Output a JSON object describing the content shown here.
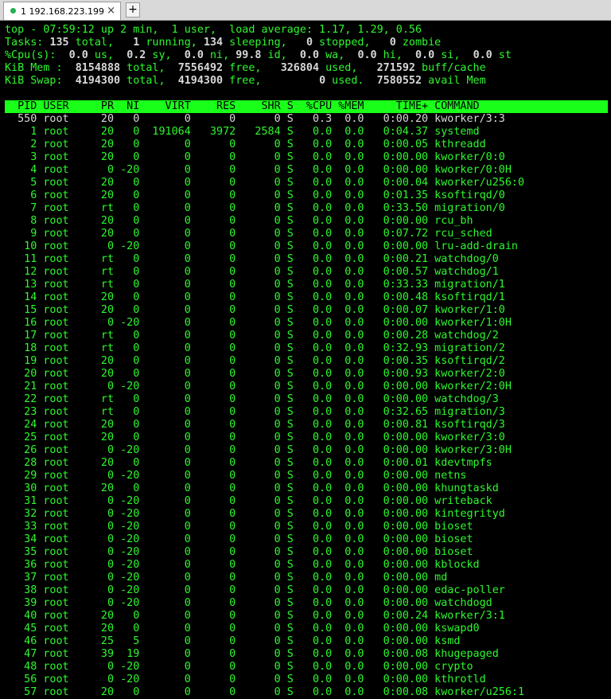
{
  "tab": {
    "title": "1 192.168.223.199",
    "close": "×",
    "new": "+"
  },
  "summary": {
    "l1": "top - 07:59:12 up 2 min,  1 user,  load average: 1.17, 1.29, 0.56",
    "tasks": [
      "135",
      "1",
      "134",
      "0",
      "0"
    ],
    "cpu": [
      "0.0",
      "0.2",
      "0.0",
      "99.8",
      "0.0",
      "0.0",
      "0.0",
      "0.0"
    ],
    "mem": [
      "8154888",
      "7556492",
      "326804",
      "271592"
    ],
    "swap": [
      "4194300",
      "4194300",
      "0",
      "7580552"
    ]
  },
  "columns": [
    "PID",
    "USER",
    "PR",
    "NI",
    "VIRT",
    "RES",
    "SHR",
    "S",
    "%CPU",
    "%MEM",
    "TIME+",
    "COMMAND"
  ],
  "processes": [
    [
      "550",
      "root",
      "20",
      "0",
      "0",
      "0",
      "0",
      "S",
      "0.3",
      "0.0",
      "0:00.20",
      "kworker/3:3"
    ],
    [
      "1",
      "root",
      "20",
      "0",
      "191064",
      "3972",
      "2584",
      "S",
      "0.0",
      "0.0",
      "0:04.37",
      "systemd"
    ],
    [
      "2",
      "root",
      "20",
      "0",
      "0",
      "0",
      "0",
      "S",
      "0.0",
      "0.0",
      "0:00.05",
      "kthreadd"
    ],
    [
      "3",
      "root",
      "20",
      "0",
      "0",
      "0",
      "0",
      "S",
      "0.0",
      "0.0",
      "0:00.00",
      "kworker/0:0"
    ],
    [
      "4",
      "root",
      "0",
      "-20",
      "0",
      "0",
      "0",
      "S",
      "0.0",
      "0.0",
      "0:00.00",
      "kworker/0:0H"
    ],
    [
      "5",
      "root",
      "20",
      "0",
      "0",
      "0",
      "0",
      "S",
      "0.0",
      "0.0",
      "0:00.04",
      "kworker/u256:0"
    ],
    [
      "6",
      "root",
      "20",
      "0",
      "0",
      "0",
      "0",
      "S",
      "0.0",
      "0.0",
      "0:01.35",
      "ksoftirqd/0"
    ],
    [
      "7",
      "root",
      "rt",
      "0",
      "0",
      "0",
      "0",
      "S",
      "0.0",
      "0.0",
      "0:33.50",
      "migration/0"
    ],
    [
      "8",
      "root",
      "20",
      "0",
      "0",
      "0",
      "0",
      "S",
      "0.0",
      "0.0",
      "0:00.00",
      "rcu_bh"
    ],
    [
      "9",
      "root",
      "20",
      "0",
      "0",
      "0",
      "0",
      "S",
      "0.0",
      "0.0",
      "0:07.72",
      "rcu_sched"
    ],
    [
      "10",
      "root",
      "0",
      "-20",
      "0",
      "0",
      "0",
      "S",
      "0.0",
      "0.0",
      "0:00.00",
      "lru-add-drain"
    ],
    [
      "11",
      "root",
      "rt",
      "0",
      "0",
      "0",
      "0",
      "S",
      "0.0",
      "0.0",
      "0:00.21",
      "watchdog/0"
    ],
    [
      "12",
      "root",
      "rt",
      "0",
      "0",
      "0",
      "0",
      "S",
      "0.0",
      "0.0",
      "0:00.57",
      "watchdog/1"
    ],
    [
      "13",
      "root",
      "rt",
      "0",
      "0",
      "0",
      "0",
      "S",
      "0.0",
      "0.0",
      "0:33.33",
      "migration/1"
    ],
    [
      "14",
      "root",
      "20",
      "0",
      "0",
      "0",
      "0",
      "S",
      "0.0",
      "0.0",
      "0:00.48",
      "ksoftirqd/1"
    ],
    [
      "15",
      "root",
      "20",
      "0",
      "0",
      "0",
      "0",
      "S",
      "0.0",
      "0.0",
      "0:00.07",
      "kworker/1:0"
    ],
    [
      "16",
      "root",
      "0",
      "-20",
      "0",
      "0",
      "0",
      "S",
      "0.0",
      "0.0",
      "0:00.00",
      "kworker/1:0H"
    ],
    [
      "17",
      "root",
      "rt",
      "0",
      "0",
      "0",
      "0",
      "S",
      "0.0",
      "0.0",
      "0:00.28",
      "watchdog/2"
    ],
    [
      "18",
      "root",
      "rt",
      "0",
      "0",
      "0",
      "0",
      "S",
      "0.0",
      "0.0",
      "0:32.93",
      "migration/2"
    ],
    [
      "19",
      "root",
      "20",
      "0",
      "0",
      "0",
      "0",
      "S",
      "0.0",
      "0.0",
      "0:00.35",
      "ksoftirqd/2"
    ],
    [
      "20",
      "root",
      "20",
      "0",
      "0",
      "0",
      "0",
      "S",
      "0.0",
      "0.0",
      "0:00.93",
      "kworker/2:0"
    ],
    [
      "21",
      "root",
      "0",
      "-20",
      "0",
      "0",
      "0",
      "S",
      "0.0",
      "0.0",
      "0:00.00",
      "kworker/2:0H"
    ],
    [
      "22",
      "root",
      "rt",
      "0",
      "0",
      "0",
      "0",
      "S",
      "0.0",
      "0.0",
      "0:00.00",
      "watchdog/3"
    ],
    [
      "23",
      "root",
      "rt",
      "0",
      "0",
      "0",
      "0",
      "S",
      "0.0",
      "0.0",
      "0:32.65",
      "migration/3"
    ],
    [
      "24",
      "root",
      "20",
      "0",
      "0",
      "0",
      "0",
      "S",
      "0.0",
      "0.0",
      "0:00.81",
      "ksoftirqd/3"
    ],
    [
      "25",
      "root",
      "20",
      "0",
      "0",
      "0",
      "0",
      "S",
      "0.0",
      "0.0",
      "0:00.00",
      "kworker/3:0"
    ],
    [
      "26",
      "root",
      "0",
      "-20",
      "0",
      "0",
      "0",
      "S",
      "0.0",
      "0.0",
      "0:00.00",
      "kworker/3:0H"
    ],
    [
      "28",
      "root",
      "20",
      "0",
      "0",
      "0",
      "0",
      "S",
      "0.0",
      "0.0",
      "0:00.01",
      "kdevtmpfs"
    ],
    [
      "29",
      "root",
      "0",
      "-20",
      "0",
      "0",
      "0",
      "S",
      "0.0",
      "0.0",
      "0:00.00",
      "netns"
    ],
    [
      "30",
      "root",
      "20",
      "0",
      "0",
      "0",
      "0",
      "S",
      "0.0",
      "0.0",
      "0:00.00",
      "khungtaskd"
    ],
    [
      "31",
      "root",
      "0",
      "-20",
      "0",
      "0",
      "0",
      "S",
      "0.0",
      "0.0",
      "0:00.00",
      "writeback"
    ],
    [
      "32",
      "root",
      "0",
      "-20",
      "0",
      "0",
      "0",
      "S",
      "0.0",
      "0.0",
      "0:00.00",
      "kintegrityd"
    ],
    [
      "33",
      "root",
      "0",
      "-20",
      "0",
      "0",
      "0",
      "S",
      "0.0",
      "0.0",
      "0:00.00",
      "bioset"
    ],
    [
      "34",
      "root",
      "0",
      "-20",
      "0",
      "0",
      "0",
      "S",
      "0.0",
      "0.0",
      "0:00.00",
      "bioset"
    ],
    [
      "35",
      "root",
      "0",
      "-20",
      "0",
      "0",
      "0",
      "S",
      "0.0",
      "0.0",
      "0:00.00",
      "bioset"
    ],
    [
      "36",
      "root",
      "0",
      "-20",
      "0",
      "0",
      "0",
      "S",
      "0.0",
      "0.0",
      "0:00.00",
      "kblockd"
    ],
    [
      "37",
      "root",
      "0",
      "-20",
      "0",
      "0",
      "0",
      "S",
      "0.0",
      "0.0",
      "0:00.00",
      "md"
    ],
    [
      "38",
      "root",
      "0",
      "-20",
      "0",
      "0",
      "0",
      "S",
      "0.0",
      "0.0",
      "0:00.00",
      "edac-poller"
    ],
    [
      "39",
      "root",
      "0",
      "-20",
      "0",
      "0",
      "0",
      "S",
      "0.0",
      "0.0",
      "0:00.00",
      "watchdogd"
    ],
    [
      "40",
      "root",
      "20",
      "0",
      "0",
      "0",
      "0",
      "S",
      "0.0",
      "0.0",
      "0:00.24",
      "kworker/3:1"
    ],
    [
      "45",
      "root",
      "20",
      "0",
      "0",
      "0",
      "0",
      "S",
      "0.0",
      "0.0",
      "0:00.00",
      "kswapd0"
    ],
    [
      "46",
      "root",
      "25",
      "5",
      "0",
      "0",
      "0",
      "S",
      "0.0",
      "0.0",
      "0:00.00",
      "ksmd"
    ],
    [
      "47",
      "root",
      "39",
      "19",
      "0",
      "0",
      "0",
      "S",
      "0.0",
      "0.0",
      "0:00.08",
      "khugepaged"
    ],
    [
      "48",
      "root",
      "0",
      "-20",
      "0",
      "0",
      "0",
      "S",
      "0.0",
      "0.0",
      "0:00.00",
      "crypto"
    ],
    [
      "56",
      "root",
      "0",
      "-20",
      "0",
      "0",
      "0",
      "S",
      "0.0",
      "0.0",
      "0:00.00",
      "kthrotld"
    ],
    [
      "57",
      "root",
      "20",
      "0",
      "0",
      "0",
      "0",
      "S",
      "0.0",
      "0.0",
      "0:00.08",
      "kworker/u256:1"
    ]
  ]
}
